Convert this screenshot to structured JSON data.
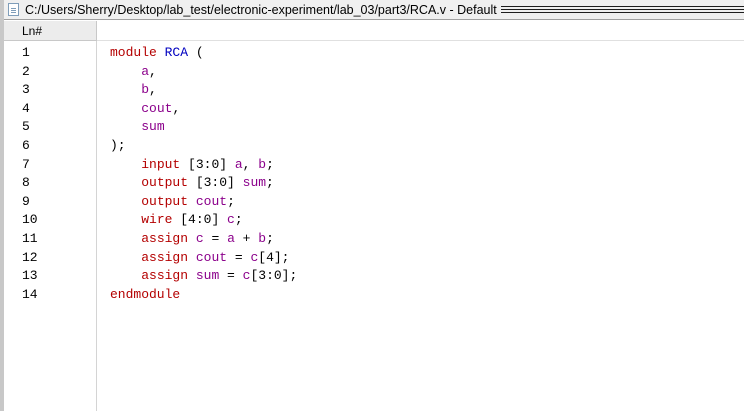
{
  "window": {
    "title": "C:/Users/Sherry/Desktop/lab_test/electronic-experiment/lab_03/part3/RCA.v - Default"
  },
  "gutter": {
    "header": "Ln#"
  },
  "colors": {
    "keyword": "#b40000",
    "module_name": "#0000c0",
    "signal": "#8b008b"
  },
  "lines": [
    {
      "n": "1",
      "tokens": [
        {
          "t": "module",
          "c": "kw"
        },
        {
          "t": " ",
          "c": "op"
        },
        {
          "t": "RCA",
          "c": "mod"
        },
        {
          "t": " (",
          "c": "op"
        }
      ]
    },
    {
      "n": "2",
      "tokens": [
        {
          "t": "    ",
          "c": "op"
        },
        {
          "t": "a",
          "c": "sig"
        },
        {
          "t": ",",
          "c": "op"
        }
      ]
    },
    {
      "n": "3",
      "tokens": [
        {
          "t": "    ",
          "c": "op"
        },
        {
          "t": "b",
          "c": "sig"
        },
        {
          "t": ",",
          "c": "op"
        }
      ]
    },
    {
      "n": "4",
      "tokens": [
        {
          "t": "    ",
          "c": "op"
        },
        {
          "t": "cout",
          "c": "sig"
        },
        {
          "t": ",",
          "c": "op"
        }
      ]
    },
    {
      "n": "5",
      "tokens": [
        {
          "t": "    ",
          "c": "op"
        },
        {
          "t": "sum",
          "c": "sig"
        }
      ]
    },
    {
      "n": "6",
      "tokens": [
        {
          "t": ");",
          "c": "op"
        }
      ]
    },
    {
      "n": "7",
      "tokens": [
        {
          "t": "    ",
          "c": "op"
        },
        {
          "t": "input",
          "c": "kw"
        },
        {
          "t": " [3:0] ",
          "c": "op"
        },
        {
          "t": "a",
          "c": "sig"
        },
        {
          "t": ", ",
          "c": "op"
        },
        {
          "t": "b",
          "c": "sig"
        },
        {
          "t": ";",
          "c": "op"
        }
      ]
    },
    {
      "n": "8",
      "tokens": [
        {
          "t": "    ",
          "c": "op"
        },
        {
          "t": "output",
          "c": "kw"
        },
        {
          "t": " [3:0] ",
          "c": "op"
        },
        {
          "t": "sum",
          "c": "sig"
        },
        {
          "t": ";",
          "c": "op"
        }
      ]
    },
    {
      "n": "9",
      "tokens": [
        {
          "t": "    ",
          "c": "op"
        },
        {
          "t": "output",
          "c": "kw"
        },
        {
          "t": " ",
          "c": "op"
        },
        {
          "t": "cout",
          "c": "sig"
        },
        {
          "t": ";",
          "c": "op"
        }
      ]
    },
    {
      "n": "10",
      "tokens": [
        {
          "t": "    ",
          "c": "op"
        },
        {
          "t": "wire",
          "c": "kw"
        },
        {
          "t": " [4:0] ",
          "c": "op"
        },
        {
          "t": "c",
          "c": "sig"
        },
        {
          "t": ";",
          "c": "op"
        }
      ]
    },
    {
      "n": "11",
      "tokens": [
        {
          "t": "    ",
          "c": "op"
        },
        {
          "t": "assign",
          "c": "kw"
        },
        {
          "t": " ",
          "c": "op"
        },
        {
          "t": "c",
          "c": "sig"
        },
        {
          "t": " = ",
          "c": "op"
        },
        {
          "t": "a",
          "c": "sig"
        },
        {
          "t": " + ",
          "c": "op"
        },
        {
          "t": "b",
          "c": "sig"
        },
        {
          "t": ";",
          "c": "op"
        }
      ]
    },
    {
      "n": "12",
      "tokens": [
        {
          "t": "    ",
          "c": "op"
        },
        {
          "t": "assign",
          "c": "kw"
        },
        {
          "t": " ",
          "c": "op"
        },
        {
          "t": "cout",
          "c": "sig"
        },
        {
          "t": " = ",
          "c": "op"
        },
        {
          "t": "c",
          "c": "sig"
        },
        {
          "t": "[4];",
          "c": "op"
        }
      ]
    },
    {
      "n": "13",
      "tokens": [
        {
          "t": "    ",
          "c": "op"
        },
        {
          "t": "assign",
          "c": "kw"
        },
        {
          "t": " ",
          "c": "op"
        },
        {
          "t": "sum",
          "c": "sig"
        },
        {
          "t": " = ",
          "c": "op"
        },
        {
          "t": "c",
          "c": "sig"
        },
        {
          "t": "[3:0];",
          "c": "op"
        }
      ]
    },
    {
      "n": "14",
      "tokens": [
        {
          "t": "endmodule",
          "c": "kw"
        }
      ]
    }
  ]
}
